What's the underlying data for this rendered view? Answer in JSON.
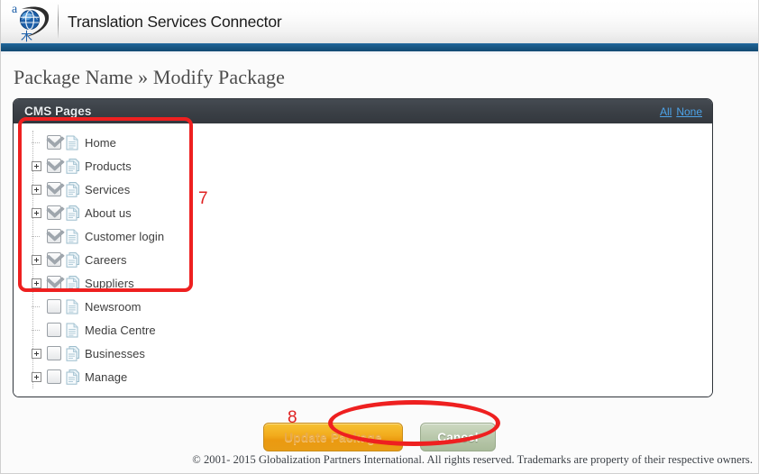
{
  "window": {
    "app_title": "Translation Services Connector",
    "logo_letter": "a",
    "logo_glyph": "木"
  },
  "breadcrumb": {
    "text": "Package Name » Modify Package"
  },
  "panel": {
    "title": "CMS Pages",
    "links": {
      "all": "All",
      "none": "None"
    },
    "tree": [
      {
        "label": "Home",
        "checked": true,
        "expandable": false,
        "multi_page": false
      },
      {
        "label": "Products",
        "checked": true,
        "expandable": true,
        "multi_page": true
      },
      {
        "label": "Services",
        "checked": true,
        "expandable": true,
        "multi_page": true
      },
      {
        "label": "About us",
        "checked": true,
        "expandable": true,
        "multi_page": true
      },
      {
        "label": "Customer login",
        "checked": true,
        "expandable": false,
        "multi_page": false
      },
      {
        "label": "Careers",
        "checked": true,
        "expandable": true,
        "multi_page": true
      },
      {
        "label": "Suppliers",
        "checked": true,
        "expandable": true,
        "multi_page": true
      },
      {
        "label": "Newsroom",
        "checked": false,
        "expandable": false,
        "multi_page": false
      },
      {
        "label": "Media Centre",
        "checked": false,
        "expandable": false,
        "multi_page": false
      },
      {
        "label": "Businesses",
        "checked": false,
        "expandable": true,
        "multi_page": true
      },
      {
        "label": "Manage",
        "checked": false,
        "expandable": true,
        "multi_page": true
      }
    ]
  },
  "actions": {
    "update_label": "Update Package",
    "cancel_label": "Cancel"
  },
  "footer": {
    "copyright": "© 2001- 2015 Globalization Partners International. All rights reserved. Trademarks are property of their respective owners."
  },
  "annotations": [
    {
      "id": "step-7",
      "number": "7"
    },
    {
      "id": "step-8",
      "number": "8"
    }
  ],
  "colors": {
    "brand_blue": "#17547f",
    "panel_header": "#3a3f45",
    "link_blue": "#4da3e8",
    "annotation_red": "#ee2020",
    "update_button_gold": "#f2ab1c",
    "cancel_button_green": "#b9c8ab"
  }
}
